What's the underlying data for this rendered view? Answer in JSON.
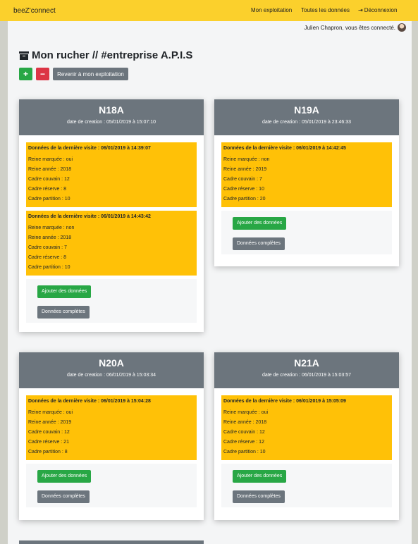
{
  "navbar": {
    "brand": "beeZ'connect",
    "links": [
      "Mon exploitation",
      "Toutes les données",
      "Déconnexion"
    ],
    "signout_icon": "sign-out-icon",
    "color": "#fbd02c"
  },
  "user": {
    "greeting": "Julien Chapron, vous êtes connecté."
  },
  "page": {
    "title": "Mon rucher // #entreprise A.P.I.S",
    "title_icon": "archive-icon",
    "add_label": "+",
    "remove_label": "−",
    "back_label": "Revenir à mon exploitation"
  },
  "hives": [
    {
      "name": "N18A",
      "created": "date de creation : 05/01/2019 à 15:07:10",
      "visits": [
        {
          "title": "Données de la dernière visite : 06/01/2019 à 14:39:07",
          "rows": [
            "Reine marquée : oui",
            "Reine année : 2018",
            "Cadre couvain : 12",
            "Cadre réserve : 8",
            "Cadre partition : 10"
          ]
        },
        {
          "title": "Données de la dernière visite : 06/01/2019 à 14:43:42",
          "rows": [
            "Reine marquée : non",
            "Reine année : 2018",
            "Cadre couvain : 7",
            "Cadre réserve : 8",
            "Cadre partition : 10"
          ]
        }
      ],
      "add_label": "Ajouter des données",
      "full_label": "Données complètes"
    },
    {
      "name": "N19A",
      "created": "date de creation : 05/01/2019 à 23:46:33",
      "visits": [
        {
          "title": "Données de la dernière visite : 06/01/2019 à 14:42:45",
          "rows": [
            "Reine marquée : non",
            "Reine année : 2019",
            "Cadre couvain : 7",
            "Cadre réserve : 10",
            "Cadre partition : 20"
          ]
        }
      ],
      "add_label": "Ajouter des données",
      "full_label": "Données complètes"
    },
    {
      "name": "N20A",
      "created": "date de creation : 06/01/2019 à 15:03:34",
      "visits": [
        {
          "title": "Données de la dernière visite : 06/01/2019 à 15:04:28",
          "rows": [
            "Reine marquée : oui",
            "Reine année : 2019",
            "Cadre couvain : 12",
            "Cadre réserve : 21",
            "Cadre partition : 8"
          ]
        }
      ],
      "add_label": "Ajouter des données",
      "full_label": "Données complètes"
    },
    {
      "name": "N21A",
      "created": "date de creation : 06/01/2019 à 15:03:57",
      "visits": [
        {
          "title": "Données de la dernière visite : 06/01/2019 à 15:05:09",
          "rows": [
            "Reine marquée : oui",
            "Reine année : 2018",
            "Cadre couvain : 12",
            "Cadre réserve : 12",
            "Cadre partition : 10"
          ]
        }
      ],
      "add_label": "Ajouter des données",
      "full_label": "Données complètes"
    }
  ]
}
